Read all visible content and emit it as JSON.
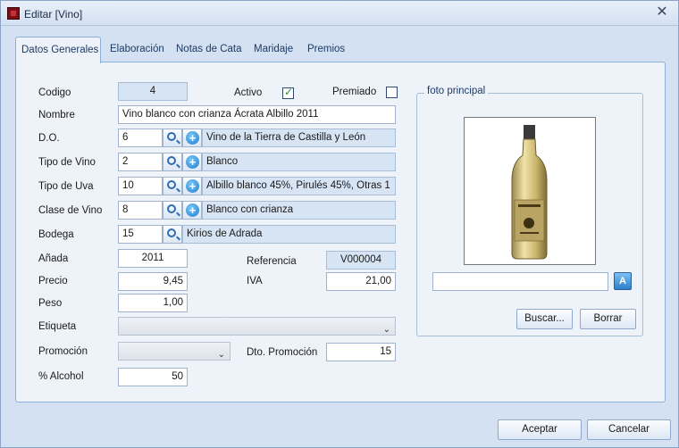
{
  "window": {
    "title": "Editar [Vino]"
  },
  "tabs": [
    {
      "label": "Datos Generales"
    },
    {
      "label": "Elaboración"
    },
    {
      "label": "Notas de Cata"
    },
    {
      "label": "Maridaje"
    },
    {
      "label": "Premios"
    }
  ],
  "form": {
    "codigo": {
      "label": "Codigo",
      "value": "4"
    },
    "activo": {
      "label": "Activo",
      "checked": true
    },
    "premiado": {
      "label": "Premiado",
      "checked": false
    },
    "nombre": {
      "label": "Nombre",
      "value": "Vino blanco con crianza Ácrata Albillo 2011"
    },
    "do": {
      "label": "D.O.",
      "code": "6",
      "desc": "Vino de la Tierra de Castilla y León"
    },
    "tipo_vino": {
      "label": "Tipo de Vino",
      "code": "2",
      "desc": "Blanco"
    },
    "tipo_uva": {
      "label": "Tipo de Uva",
      "code": "10",
      "desc": "Albillo blanco 45%, Pirulés 45%, Otras 1"
    },
    "clase_vino": {
      "label": "Clase de Vino",
      "code": "8",
      "desc": "Blanco con crianza"
    },
    "bodega": {
      "label": "Bodega",
      "code": "15",
      "desc": "Kirios de Adrada"
    },
    "anada": {
      "label": "Añada",
      "value": "2011"
    },
    "referencia": {
      "label": "Referencia",
      "value": "V000004"
    },
    "precio": {
      "label": "Precio",
      "value": "9,45"
    },
    "iva": {
      "label": "IVA",
      "value": "21,00"
    },
    "peso": {
      "label": "Peso",
      "value": "1,00"
    },
    "etiqueta": {
      "label": "Etiqueta",
      "value": ""
    },
    "promocion": {
      "label": "Promoción",
      "value": ""
    },
    "dto_promocion": {
      "label": "Dto. Promoción",
      "value": "15"
    },
    "alcohol": {
      "label": "% Alcohol",
      "value": "50"
    }
  },
  "photo": {
    "legend": "foto principal",
    "path_value": "",
    "search_button": "Buscar...",
    "delete_button": "Borrar"
  },
  "footer": {
    "accept": "Aceptar",
    "cancel": "Cancelar"
  },
  "icons": {
    "app": "wine-app-icon",
    "close": "close-icon",
    "search": "search-icon",
    "add": "add-icon",
    "dropdown": "chevron-down-icon",
    "dictionary": "dictionary-icon",
    "bottle": "wine-bottle-image"
  }
}
